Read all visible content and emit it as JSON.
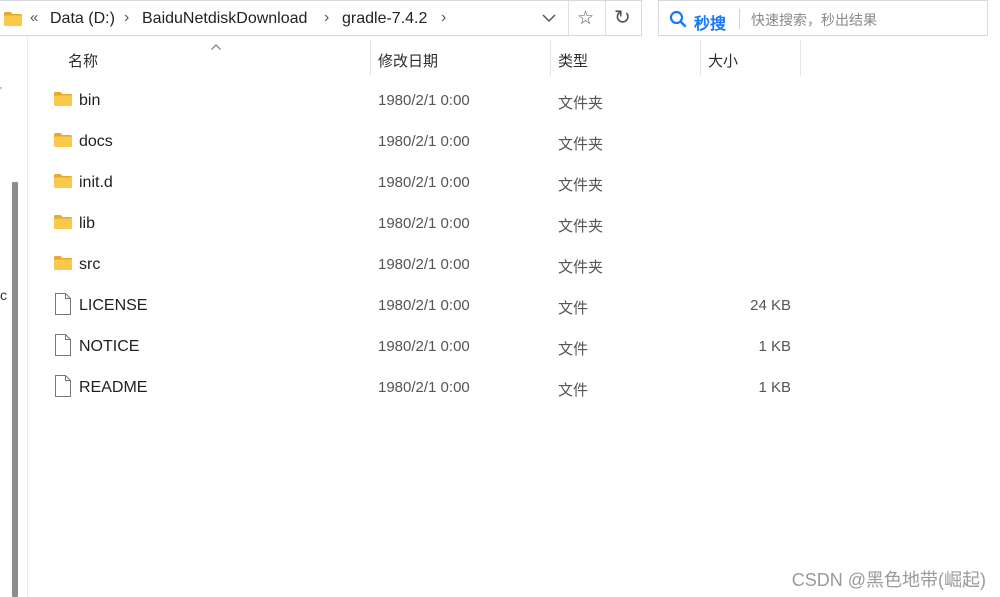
{
  "address_bar": {
    "overflow_glyph": "«",
    "crumbs": [
      "Data (D:)",
      "BaiduNetdiskDownload",
      "gradle-7.4.2"
    ],
    "separator": "›",
    "dropdown_icon": "chevron-down-icon",
    "favorite_icon": "star-outline-icon",
    "refresh_glyph": "↻"
  },
  "search": {
    "brand": "秒搜",
    "placeholder": "快速搜索，秒出结果",
    "value": ""
  },
  "left_pane": {
    "cut_text": "c"
  },
  "columns": {
    "name": "名称",
    "date": "修改日期",
    "type": "类型",
    "size": "大小",
    "sort_indicator": "^"
  },
  "files": [
    {
      "name": "bin",
      "date": "1980/2/1 0:00",
      "type": "文件夹",
      "size": "",
      "icon": "folder-icon"
    },
    {
      "name": "docs",
      "date": "1980/2/1 0:00",
      "type": "文件夹",
      "size": "",
      "icon": "folder-icon"
    },
    {
      "name": "init.d",
      "date": "1980/2/1 0:00",
      "type": "文件夹",
      "size": "",
      "icon": "folder-icon"
    },
    {
      "name": "lib",
      "date": "1980/2/1 0:00",
      "type": "文件夹",
      "size": "",
      "icon": "folder-icon"
    },
    {
      "name": "src",
      "date": "1980/2/1 0:00",
      "type": "文件夹",
      "size": "",
      "icon": "folder-icon"
    },
    {
      "name": "LICENSE",
      "date": "1980/2/1 0:00",
      "type": "文件",
      "size": "24 KB",
      "icon": "file-icon"
    },
    {
      "name": "NOTICE",
      "date": "1980/2/1 0:00",
      "type": "文件",
      "size": "1 KB",
      "icon": "file-icon"
    },
    {
      "name": "README",
      "date": "1980/2/1 0:00",
      "type": "文件",
      "size": "1 KB",
      "icon": "file-icon"
    }
  ],
  "watermark": "CSDN @黑色地带(崛起)",
  "colors": {
    "folder": "#f8c94a",
    "folder_tab": "#e7aa2c",
    "search_brand": "#1677ff",
    "scrollbar": "#8c8c8c"
  }
}
